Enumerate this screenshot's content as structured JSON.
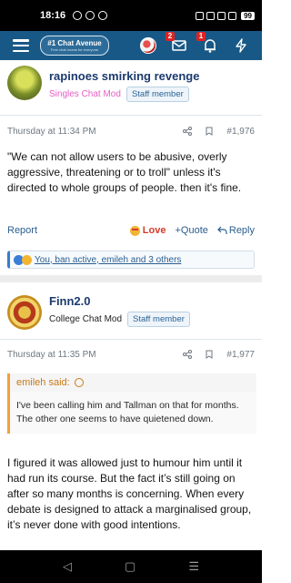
{
  "status_bar": {
    "time": "18:16",
    "battery": "99"
  },
  "header": {
    "logo_main": "#1 Chat Avenue",
    "logo_sub": "Free chat rooms for everyone",
    "messages_badge": "2",
    "alerts_badge": "1"
  },
  "post1": {
    "author": "rapinoes smirking revenge",
    "user_title": "Singles Chat Mod",
    "staff_label": "Staff member",
    "timestamp": "Thursday at 11:34 PM",
    "number": "#1,976",
    "text": "\"We can not allow users to be abusive, overly aggressive, threatening or to troll\" unless it's directed to whole groups of people. then it's fine.",
    "report_label": "Report",
    "love_label": "Love",
    "quote_label": "+Quote",
    "reply_label": "Reply",
    "reactions_text": "You, ban active, emileh and 3 others"
  },
  "post2": {
    "author": "Finn2.0",
    "user_title": "College Chat Mod",
    "staff_label": "Staff member",
    "timestamp": "Thursday at 11:35 PM",
    "number": "#1,977",
    "quote_author": "emileh said:",
    "quote_text": "I've been calling him and Tallman on that for months. The other one seems to have quietened down.",
    "text": "I figured it was allowed just to humour him until it had run its course. But the fact it’s still going on after so many months is concerning. When every debate is designed to attack a marginalised group, it’s never done with good intentions."
  },
  "nav": {
    "back": "◁",
    "home": "▢",
    "recents": "☰"
  }
}
